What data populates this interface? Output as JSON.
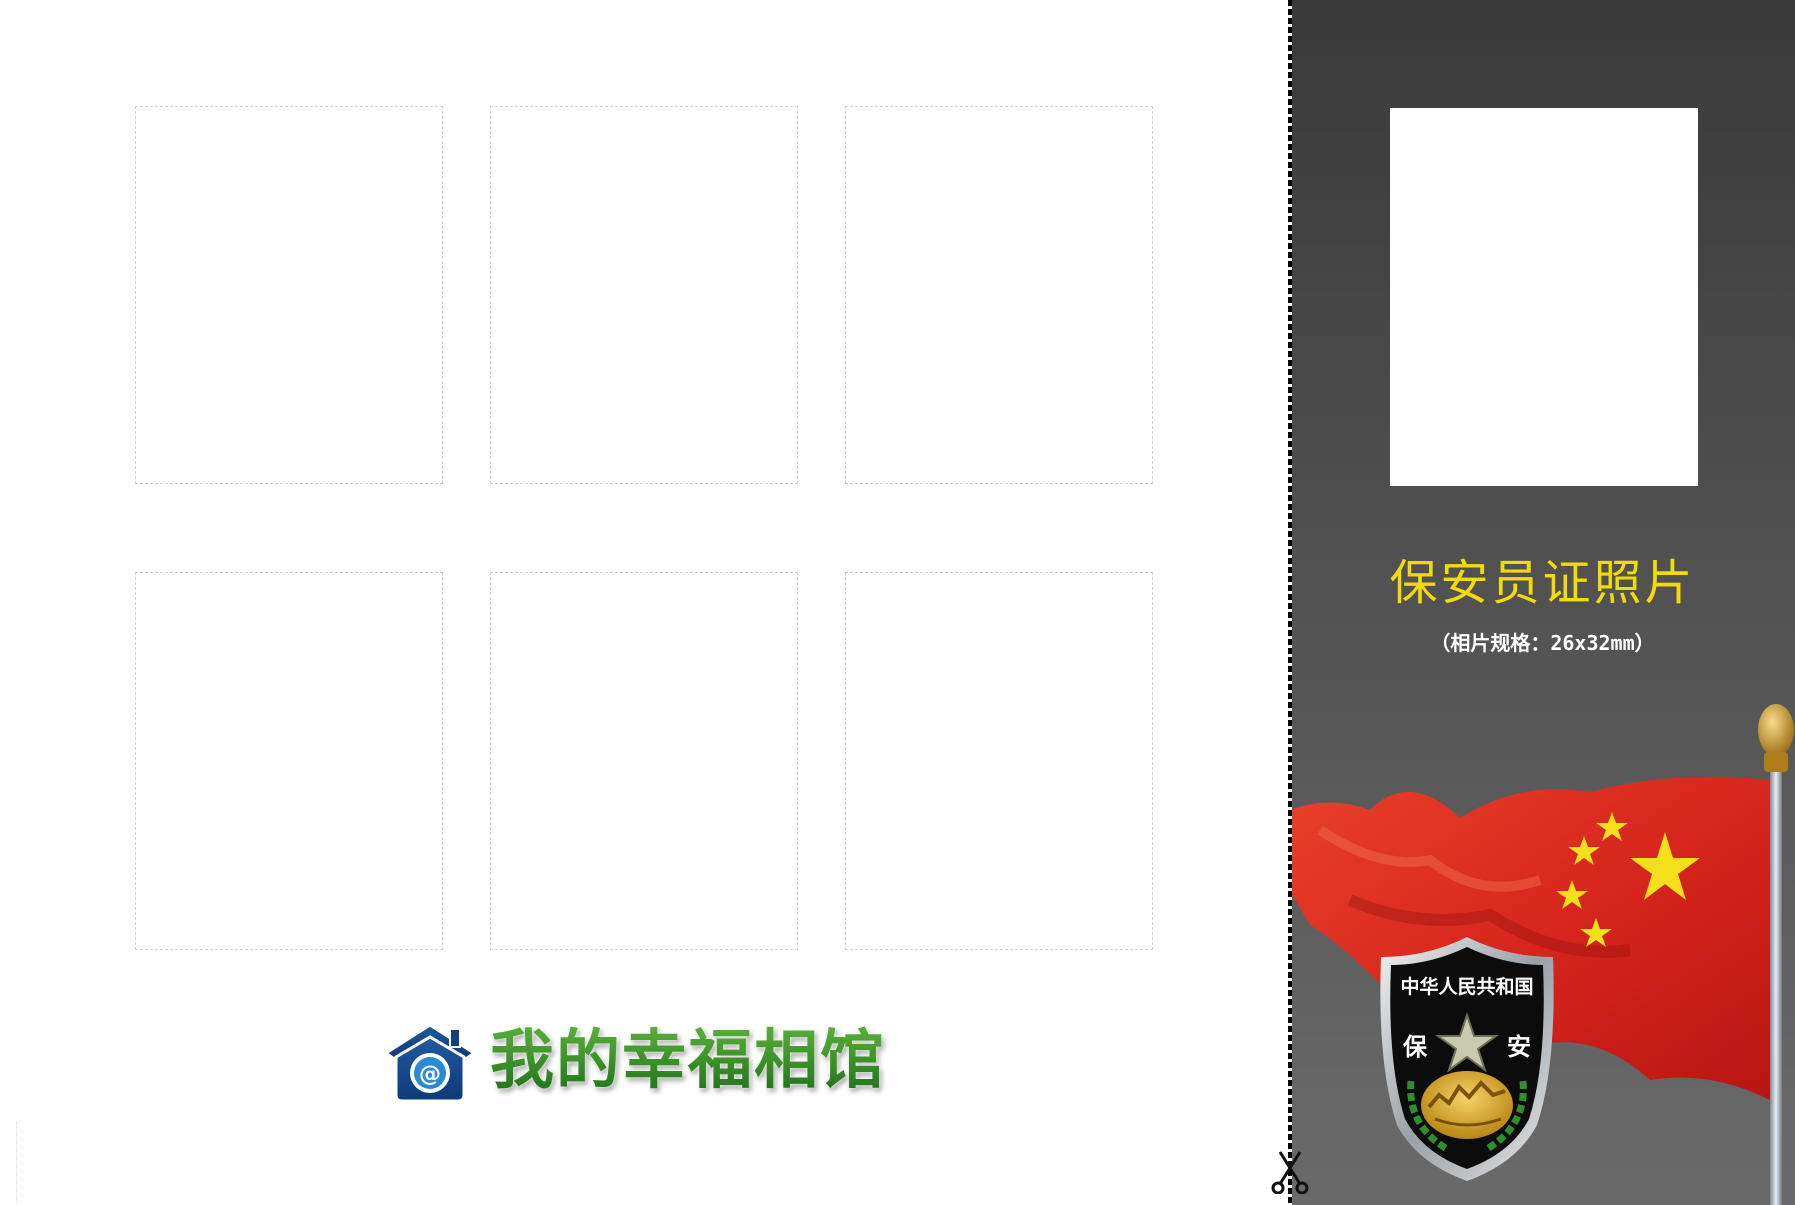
{
  "photo_sheet": {
    "slots": [
      "",
      "",
      "",
      "",
      "",
      ""
    ]
  },
  "brand": {
    "name": "我的幸福相馆",
    "icon": "house-at-icon"
  },
  "panel": {
    "title": "保安员证照片",
    "spec": "（相片规格：26x32mm）",
    "badge": {
      "top_text": "中华人民共和国",
      "left_char": "保",
      "right_char": "安"
    },
    "flag_color": "#d7261d",
    "star_color": "#f4e01a",
    "title_color": "#f3db0a"
  },
  "cut_icon": "scissors-icon"
}
